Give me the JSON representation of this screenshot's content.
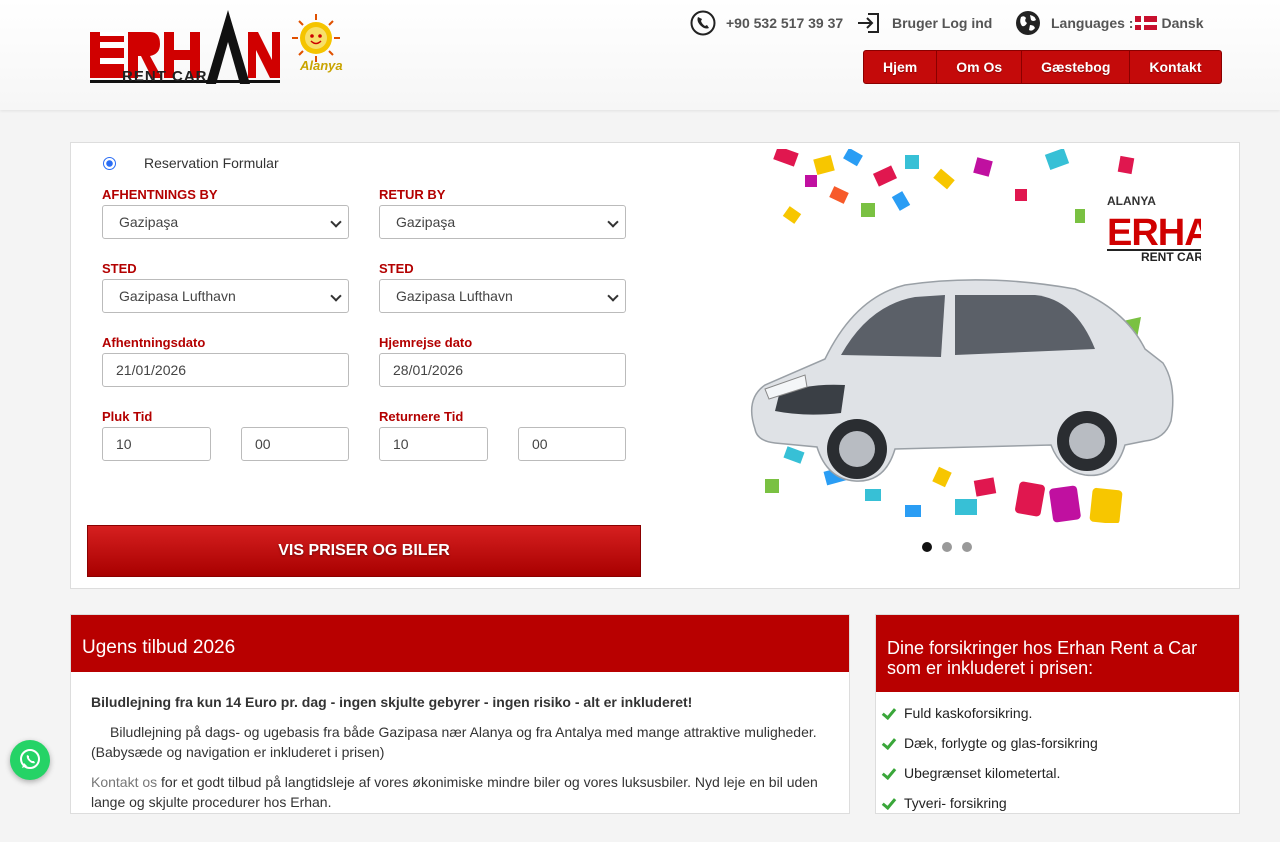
{
  "header": {
    "logo_text": "ERHAN",
    "logo_sub": "RENT  CAR",
    "logo_alanya": "Alanya",
    "phone": "+90 532 517 39 37",
    "login": "Bruger Log ind",
    "languages_label": "Languages :",
    "language": "Dansk",
    "nav": [
      "Hjem",
      "Om Os",
      "Gæstebog",
      "Kontakt"
    ]
  },
  "form": {
    "radio_label": "Reservation Formular",
    "pickup_city_label": "AFHENTNINGS BY",
    "pickup_city": "Gazipaşa",
    "return_city_label": "RETUR BY",
    "return_city": "Gazipaşa",
    "pickup_place_label": "STED",
    "pickup_place": "Gazipasa Lufthavn",
    "return_place_label": "STED",
    "return_place": "Gazipasa Lufthavn",
    "pickup_date_label": "Afhentningsdato",
    "pickup_date": "21/01/2026",
    "return_date_label": "Hjemrejse dato",
    "return_date": "28/01/2026",
    "pickup_time_label": "Pluk Tid",
    "pickup_hour": "10",
    "pickup_min": "00",
    "return_time_label": "Returnere Tid",
    "return_hour": "10",
    "return_min": "00",
    "submit": "VIS PRISER OG BILER"
  },
  "slider": {
    "brand_top": "ALANYA",
    "brand": "ERHAN",
    "brand_sub": "RENT  CAR",
    "slide_count": 3,
    "active_slide": 1
  },
  "offer": {
    "title": "Ugens tilbud 2026",
    "headline": "Biludlejning fra kun 14 Euro pr. dag - ingen skjulte gebyrer - ingen risiko - alt er inkluderet!",
    "para1": "Biludlejning på dags- og ugebasis fra både Gazipasa nær Alanya og fra Antalya med mange attraktive muligheder. (Babysæde og navigation er inkluderet i prisen)",
    "contact_link": "Kontakt os",
    "para2": " for et godt tilbud på langtidsleje af vores økonimiske mindre biler og vores luksusbiler. Nyd leje en bil uden lange og skjulte procedurer hos Erhan."
  },
  "insurance": {
    "title": "Dine forsikringer hos Erhan Rent a Car som er inkluderet i prisen:",
    "items": [
      "Fuld kaskoforsikring.",
      "Dæk, forlygte og glas-forsikring",
      "Ubegrænset kilometertal.",
      "Tyveri- forsikring"
    ]
  },
  "colors": {
    "brand_red": "#b80000",
    "check_green": "#3aa63a",
    "whatsapp": "#25d366"
  }
}
